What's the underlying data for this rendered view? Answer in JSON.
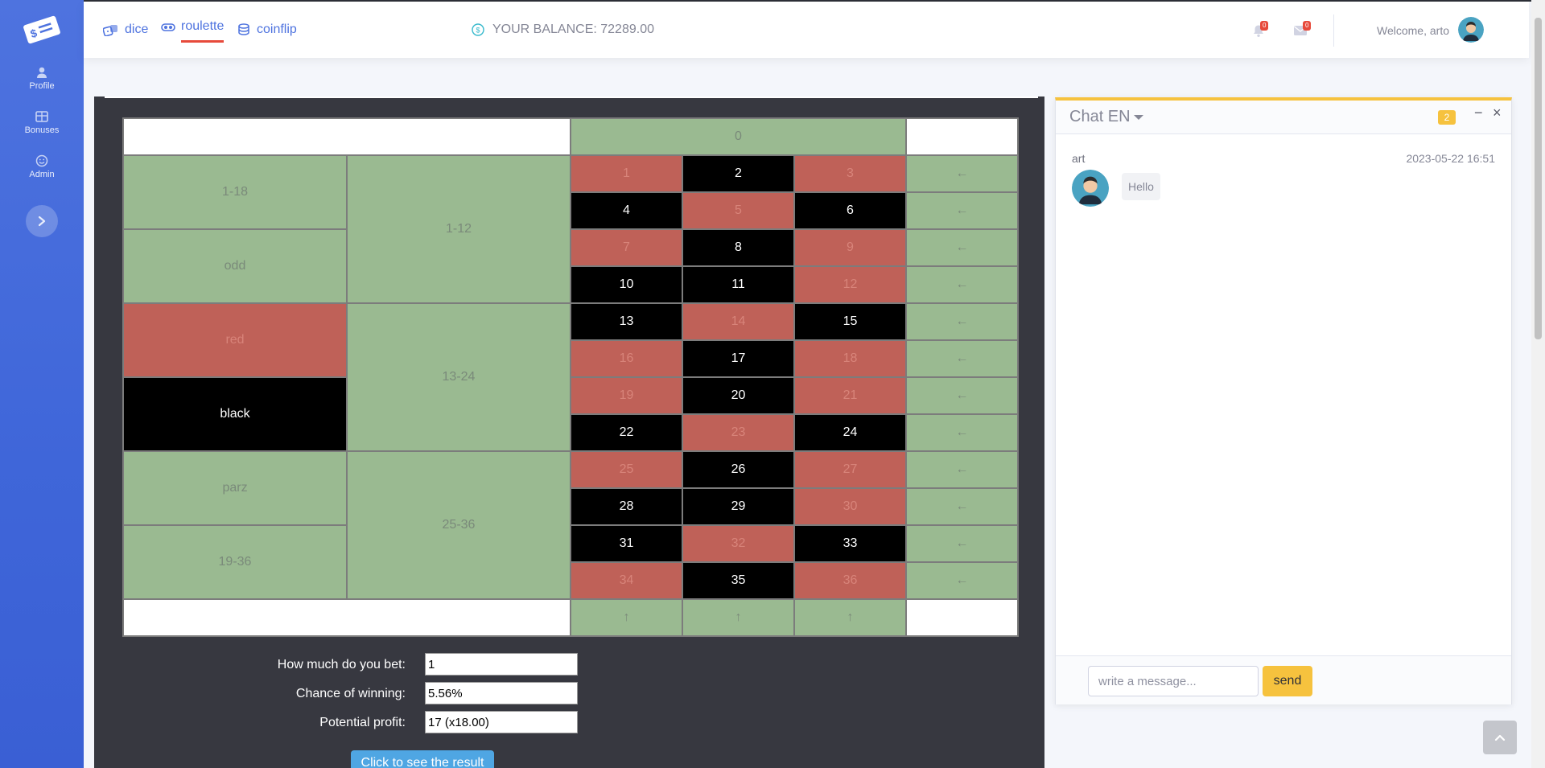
{
  "sidebar": {
    "items": [
      {
        "label": "Profile",
        "icon": "user-icon"
      },
      {
        "label": "Bonuses",
        "icon": "table-icon"
      },
      {
        "label": "Admin",
        "icon": "smile-icon"
      }
    ]
  },
  "topbar": {
    "tabs": [
      {
        "label": "dice",
        "icon": "dice-icon",
        "active": false
      },
      {
        "label": "roulette",
        "icon": "roulette-icon",
        "active": true
      },
      {
        "label": "coinflip",
        "icon": "coins-icon",
        "active": false
      }
    ],
    "balance_text": "YOUR BALANCE: 72289.00",
    "alerts_count": "0",
    "messages_count": "0",
    "welcome_text": "Welcome, arto"
  },
  "roulette": {
    "zero": "0",
    "outside_left": [
      "1-18",
      "odd",
      "red",
      "black",
      "parz",
      "19-36"
    ],
    "dozens": [
      "1-12",
      "13-24",
      "25-36"
    ],
    "rows": [
      [
        {
          "n": "1",
          "c": "r"
        },
        {
          "n": "2",
          "c": "b"
        },
        {
          "n": "3",
          "c": "r"
        }
      ],
      [
        {
          "n": "4",
          "c": "b"
        },
        {
          "n": "5",
          "c": "r"
        },
        {
          "n": "6",
          "c": "b"
        }
      ],
      [
        {
          "n": "7",
          "c": "r"
        },
        {
          "n": "8",
          "c": "b"
        },
        {
          "n": "9",
          "c": "r"
        }
      ],
      [
        {
          "n": "10",
          "c": "b"
        },
        {
          "n": "11",
          "c": "b"
        },
        {
          "n": "12",
          "c": "r"
        }
      ],
      [
        {
          "n": "13",
          "c": "b"
        },
        {
          "n": "14",
          "c": "r"
        },
        {
          "n": "15",
          "c": "b"
        }
      ],
      [
        {
          "n": "16",
          "c": "r"
        },
        {
          "n": "17",
          "c": "b"
        },
        {
          "n": "18",
          "c": "r"
        }
      ],
      [
        {
          "n": "19",
          "c": "r"
        },
        {
          "n": "20",
          "c": "b"
        },
        {
          "n": "21",
          "c": "r"
        }
      ],
      [
        {
          "n": "22",
          "c": "b"
        },
        {
          "n": "23",
          "c": "r"
        },
        {
          "n": "24",
          "c": "b"
        }
      ],
      [
        {
          "n": "25",
          "c": "r"
        },
        {
          "n": "26",
          "c": "b"
        },
        {
          "n": "27",
          "c": "r"
        }
      ],
      [
        {
          "n": "28",
          "c": "b"
        },
        {
          "n": "29",
          "c": "b"
        },
        {
          "n": "30",
          "c": "r"
        }
      ],
      [
        {
          "n": "31",
          "c": "b"
        },
        {
          "n": "32",
          "c": "r"
        },
        {
          "n": "33",
          "c": "b"
        }
      ],
      [
        {
          "n": "34",
          "c": "r"
        },
        {
          "n": "35",
          "c": "b"
        },
        {
          "n": "36",
          "c": "r"
        }
      ]
    ],
    "row_arrow": "←",
    "column_arrow": "↑"
  },
  "bet": {
    "bet_label": "How much do you bet:",
    "bet_value": "1",
    "chance_label": "Chance of winning:",
    "chance_value": "5.56%",
    "profit_label": "Potential profit:",
    "profit_value": "17 (x18.00)",
    "submit_label": "Click to see the result"
  },
  "chat": {
    "title": "Chat EN",
    "count": "2",
    "minimize": "−",
    "close": "×",
    "messages": [
      {
        "user": "art",
        "time": "2023-05-22 16:51",
        "text": "Hello"
      }
    ],
    "input_placeholder": "write a message...",
    "send_label": "send"
  },
  "colors": {
    "sidebar": "#4e73df",
    "green": "#9aba91",
    "red": "#bf6158",
    "black": "#000000",
    "accent_yellow": "#f6c23e",
    "active_tab_underline": "#e74a3b"
  }
}
